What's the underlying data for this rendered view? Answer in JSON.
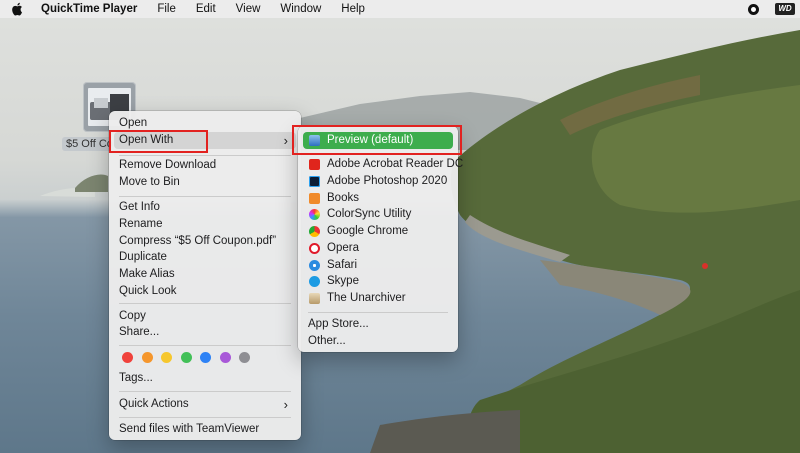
{
  "menubar": {
    "app_name": "QuickTime Player",
    "items": [
      "File",
      "Edit",
      "View",
      "Window",
      "Help"
    ]
  },
  "desktop": {
    "file_label": "$5 Off Coupon.pdf",
    "file_label_visible": "$5 Off Co"
  },
  "context_menu": {
    "open": "Open",
    "open_with": "Open With",
    "remove_download": "Remove Download",
    "move_to_bin": "Move to Bin",
    "get_info": "Get Info",
    "rename": "Rename",
    "compress": "Compress “$5 Off Coupon.pdf”",
    "duplicate": "Duplicate",
    "make_alias": "Make Alias",
    "quick_look": "Quick Look",
    "copy": "Copy",
    "share": "Share...",
    "tag_colors": [
      "#f0423c",
      "#f5962c",
      "#f6c72e",
      "#42c058",
      "#2e82f5",
      "#a858d8",
      "#8e8e93"
    ],
    "tags": "Tags...",
    "quick_actions": "Quick Actions",
    "teamviewer": "Send files with TeamViewer",
    "chevron": "›"
  },
  "submenu": {
    "default_app": "Preview (default)",
    "apps": [
      {
        "label": "Adobe Acrobat Reader DC",
        "icon": "acrobat-icon"
      },
      {
        "label": "Adobe Photoshop 2020",
        "icon": "photoshop-icon"
      },
      {
        "label": "Books",
        "icon": "books-icon"
      },
      {
        "label": "ColorSync Utility",
        "icon": "colorsync-icon"
      },
      {
        "label": "Google Chrome",
        "icon": "chrome-icon"
      },
      {
        "label": "Opera",
        "icon": "opera-icon"
      },
      {
        "label": "Safari",
        "icon": "safari-icon"
      },
      {
        "label": "Skype",
        "icon": "skype-icon"
      },
      {
        "label": "The Unarchiver",
        "icon": "unarchiver-icon"
      }
    ],
    "app_store": "App Store...",
    "other": "Other..."
  },
  "colors": {
    "highlight_green": "#3dad4d",
    "annotation_red": "#e22220"
  }
}
